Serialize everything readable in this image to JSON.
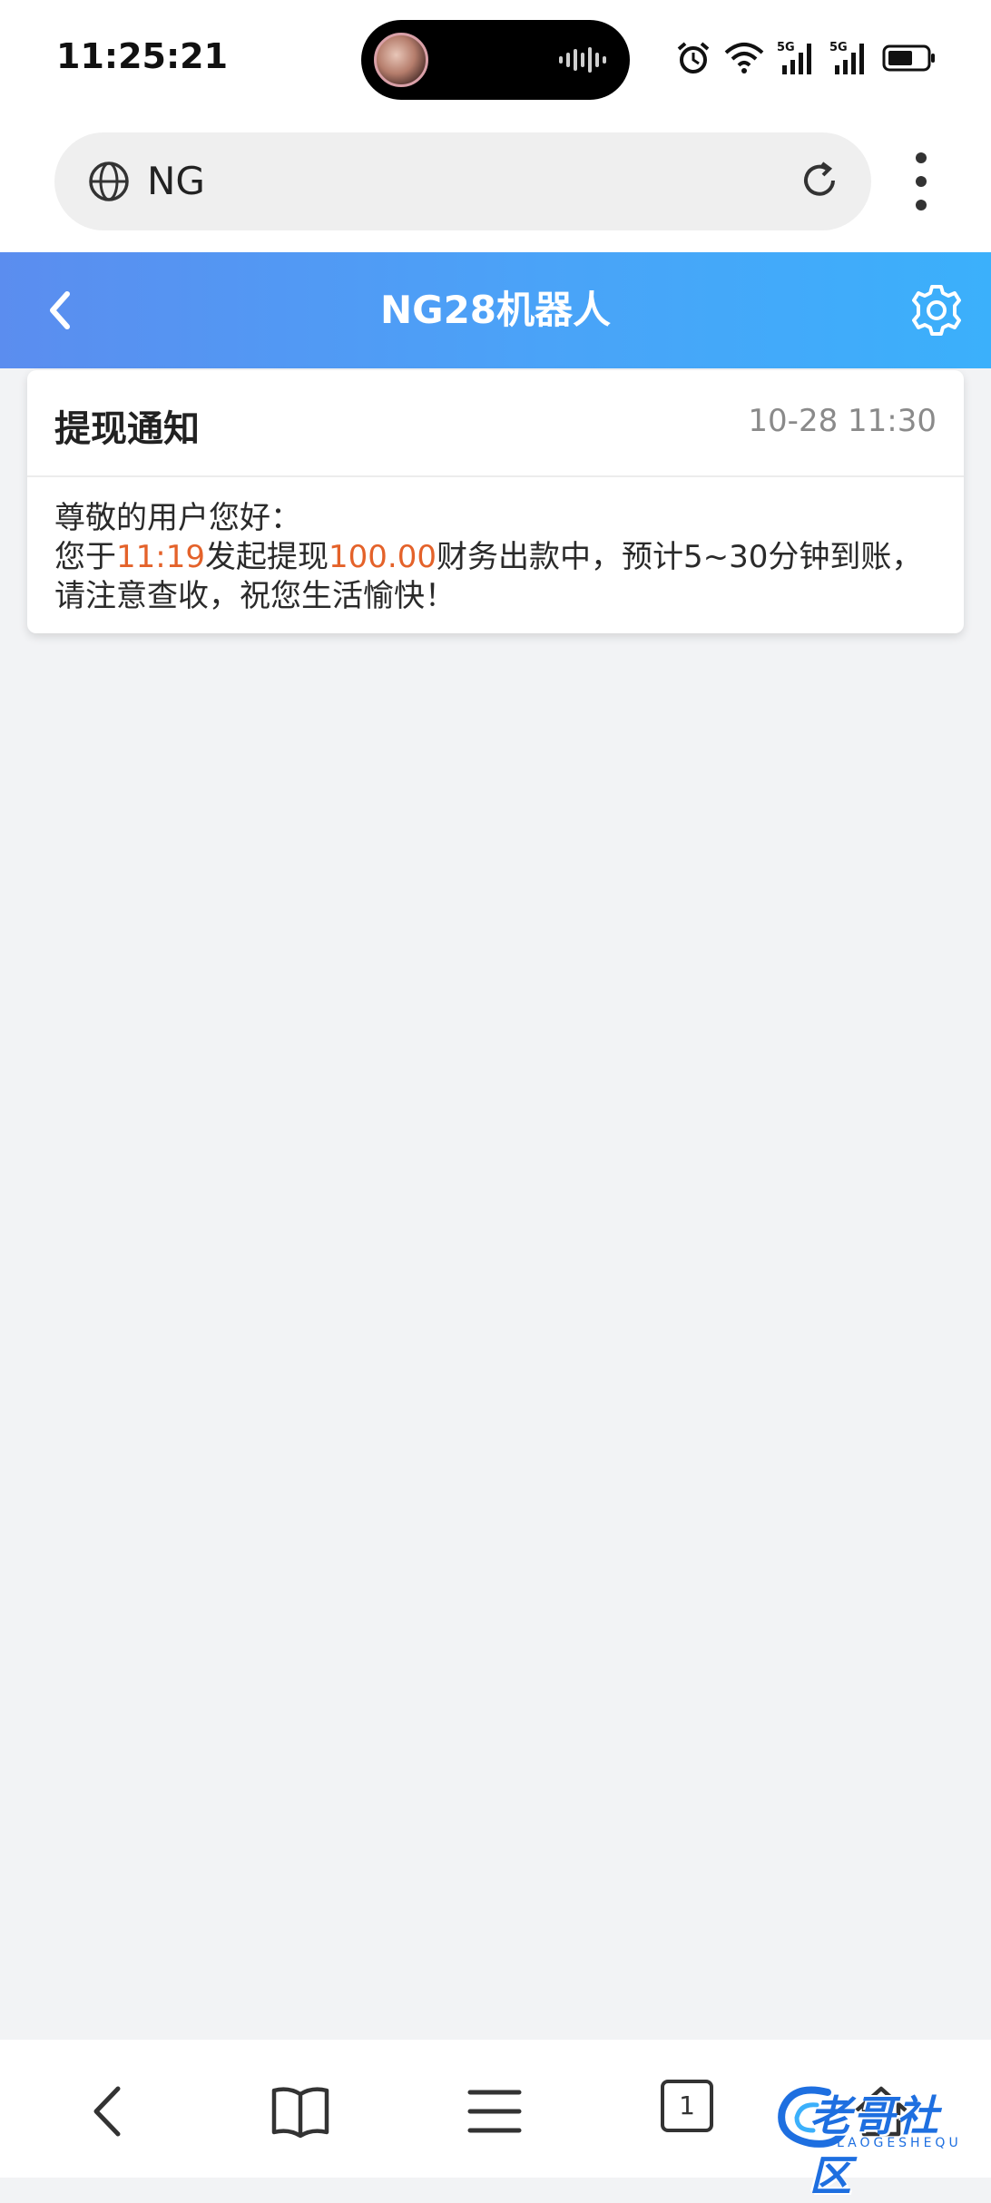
{
  "status_bar": {
    "time": "11:25:21",
    "icons": [
      "alarm-icon",
      "wifi-icon",
      "signal-5g-icon",
      "signal-5g-icon",
      "battery-icon"
    ]
  },
  "browser": {
    "url_text": "NG",
    "tab_count": "1"
  },
  "app_header": {
    "title": "NG28机器人"
  },
  "notification": {
    "title": "提现通知",
    "time": "10-28 11:30",
    "greeting": "尊敬的用户您好：",
    "line_prefix": "您于",
    "start_time": "11:19",
    "mid_text": "发起提现",
    "amount": "100.00",
    "suffix_text": "财务出款中，预计5~30分钟到账，",
    "closing": "请注意查收，祝您生活愉快！"
  },
  "watermark": {
    "text": "老哥社区",
    "sub": "LAOGESHEQU"
  },
  "colors": {
    "header_gradient_start": "#5b8def",
    "header_gradient_end": "#3bb0fb",
    "highlight": "#e4622a",
    "page_bg": "#f2f3f5"
  }
}
